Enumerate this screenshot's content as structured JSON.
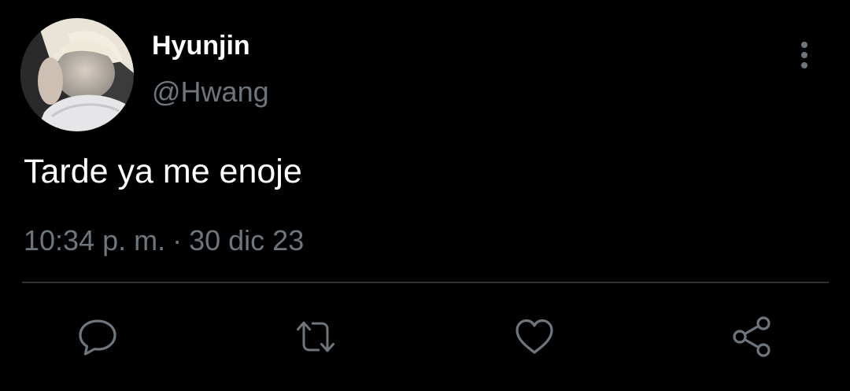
{
  "tweet": {
    "author": {
      "display_name": "Hyunjin",
      "handle": "@Hwang",
      "avatar_icon": "profile-photo"
    },
    "text": "Tarde ya me enoje",
    "time": "10:34 p. m.",
    "separator": "·",
    "date": "30 dic 23"
  },
  "actions": {
    "reply_icon": "speech-bubble-icon",
    "retweet_icon": "retweet-arrows-icon",
    "like_icon": "heart-icon",
    "share_icon": "share-nodes-icon",
    "more_icon": "vertical-ellipsis-icon"
  },
  "colors": {
    "background": "#000000",
    "primary_text": "#ffffff",
    "secondary_text": "#6e767d",
    "divider": "#2f3336"
  }
}
